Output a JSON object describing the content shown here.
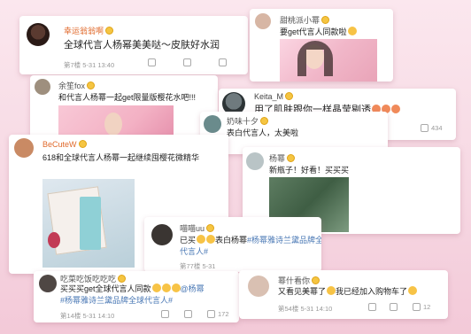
{
  "colors": {
    "background": "#f6d7e2",
    "username": "#e06a2c",
    "hashtag": "#4a78b5"
  },
  "posts": [
    {
      "user": "幸运翁翁啊",
      "text": "全球代言人杨幂美美哒～皮肤好水润",
      "floor": "第7楼",
      "time": "5-31 13:40"
    },
    {
      "user": "甜桃派小幂",
      "text": "要get代言人同款啦"
    },
    {
      "user": "余笙fox",
      "text": "和代言人杨幂一起get限量版樱花水吧!!!"
    },
    {
      "user": "Keita_M",
      "text": "用了肌肤跟你一样晶莹剔透",
      "likes": "434"
    },
    {
      "user": "奶味十夕",
      "text": "表白代言人，太美啦"
    },
    {
      "user": "BeCuteW",
      "text": "618和全球代言人杨幂一起继续囤樱花微精华"
    },
    {
      "user": "杨幂",
      "text": "新瓶子！好看！买买买"
    },
    {
      "user": "喵喵uu",
      "text": "已买",
      "text2": "表白杨幂",
      "tag1": "#杨幂雅诗兰黛品牌全球",
      "tag1b": "代言人#",
      "floor": "第77楼",
      "time": "5-31"
    },
    {
      "user": "吃菜吃饭吃吃吃",
      "text": "买买买get全球代言人同款",
      "mention": "@杨幂",
      "tag1": "#杨幂雅诗兰黛品牌全球代言人#",
      "floor": "第14楼",
      "time": "5-31 14:10",
      "likes": "172"
    },
    {
      "user": "幂什看你",
      "text": "又看见美幂了",
      "text2": "我已经加入购物车了",
      "floor": "第54楼",
      "time": "5-31 14:10",
      "likes": "12"
    }
  ]
}
